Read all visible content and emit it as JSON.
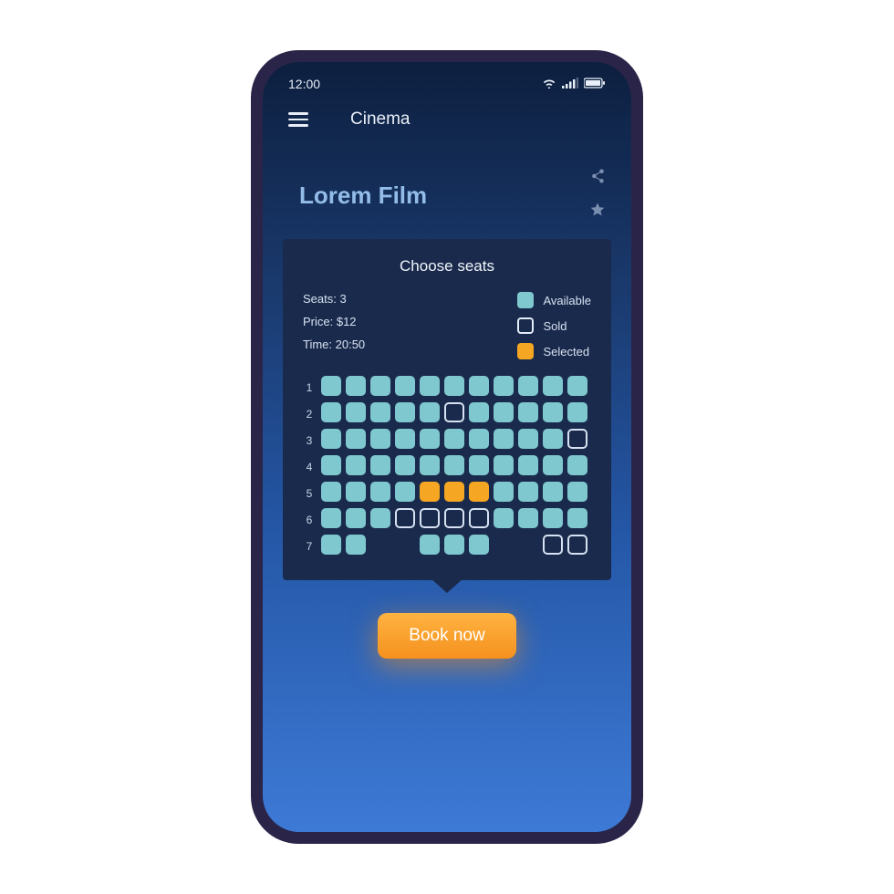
{
  "statusbar": {
    "time": "12:00"
  },
  "header": {
    "title": "Cinema"
  },
  "movie": {
    "title": "Lorem Film"
  },
  "panel": {
    "title": "Choose seats",
    "seats_label": "Seats: 3",
    "price_label": "Price: $12",
    "time_label": "Time: 20:50"
  },
  "legend": {
    "available": "Available",
    "sold": "Sold",
    "selected": "Selected"
  },
  "rows": [
    "1",
    "2",
    "3",
    "4",
    "5",
    "6",
    "7"
  ],
  "seat_map": [
    [
      "available",
      "available",
      "available",
      "available",
      "available",
      "available",
      "available",
      "available",
      "available",
      "available",
      "available"
    ],
    [
      "available",
      "available",
      "available",
      "available",
      "available",
      "sold",
      "available",
      "available",
      "available",
      "available",
      "available"
    ],
    [
      "available",
      "available",
      "available",
      "available",
      "available",
      "available",
      "available",
      "available",
      "available",
      "available",
      "sold"
    ],
    [
      "available",
      "available",
      "available",
      "available",
      "available",
      "available",
      "available",
      "available",
      "available",
      "available",
      "available"
    ],
    [
      "available",
      "available",
      "available",
      "available",
      "selected",
      "selected",
      "selected",
      "available",
      "available",
      "available",
      "available"
    ],
    [
      "available",
      "available",
      "available",
      "sold",
      "sold",
      "sold",
      "sold",
      "available",
      "available",
      "available",
      "available"
    ],
    [
      "available",
      "available",
      "gap",
      "gap",
      "available",
      "available",
      "available",
      "gap",
      "gap",
      "sold",
      "sold"
    ]
  ],
  "cta": {
    "label": "Book now"
  }
}
